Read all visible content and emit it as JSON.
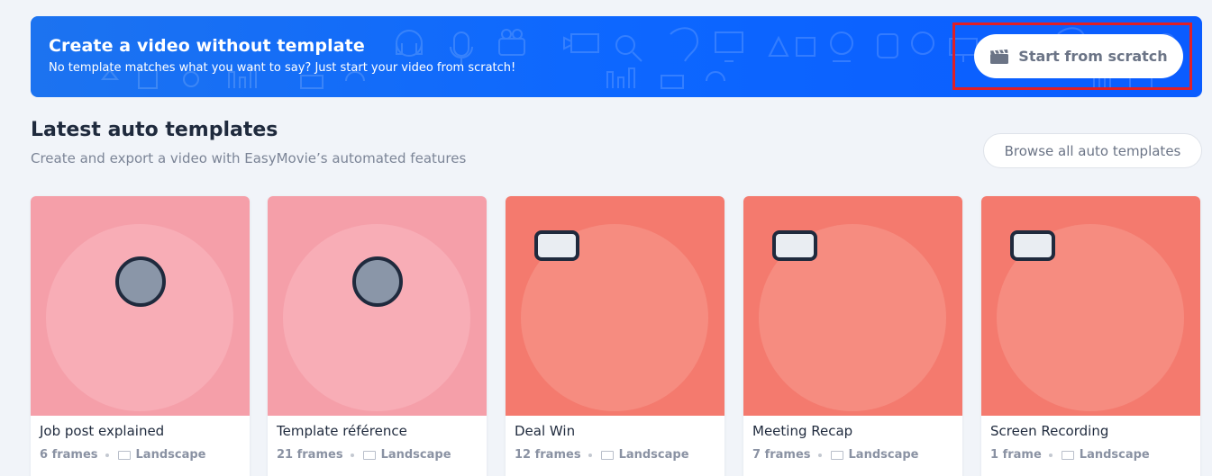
{
  "banner": {
    "title": "Create a video without template",
    "subtitle": "No template matches what you want to say? Just start your video from scratch!",
    "button_label": "Start from scratch"
  },
  "section": {
    "title": "Latest auto templates",
    "subtitle": "Create and export a video with EasyMovie’s automated features",
    "browse_label": "Browse all auto templates"
  },
  "templates": [
    {
      "title": "Job post explained",
      "frames": "6 frames",
      "format": "Landscape",
      "theme": "camera",
      "bg": "#f59fa9",
      "circle": "#f8adb6"
    },
    {
      "title": "Template référence",
      "frames": "21 frames",
      "format": "Landscape",
      "theme": "camera",
      "bg": "#f59fa9",
      "circle": "#f8adb6"
    },
    {
      "title": "Deal Win",
      "frames": "12 frames",
      "format": "Landscape",
      "theme": "plane",
      "bg": "#f47a6e",
      "circle": "#f68c80"
    },
    {
      "title": "Meeting Recap",
      "frames": "7 frames",
      "format": "Landscape",
      "theme": "plane",
      "bg": "#f47a6e",
      "circle": "#f68c80"
    },
    {
      "title": "Screen Recording",
      "frames": "1 frame",
      "format": "Landscape",
      "theme": "plane",
      "bg": "#f47a6e",
      "circle": "#f68c80"
    }
  ],
  "colors": {
    "banner": "#0d67ff",
    "highlight": "#e01f26",
    "page_bg": "#f1f4f9"
  }
}
